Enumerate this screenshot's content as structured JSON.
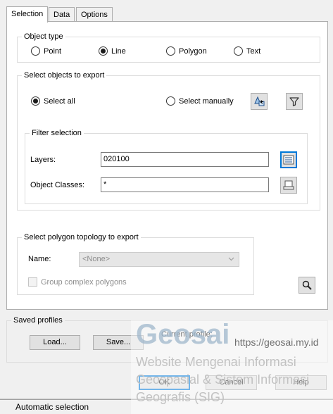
{
  "tabs": [
    {
      "label": "Selection",
      "active": true
    },
    {
      "label": "Data",
      "active": false
    },
    {
      "label": "Options",
      "active": false
    }
  ],
  "object_type": {
    "title": "Object type",
    "options": [
      {
        "label": "Point",
        "checked": false
      },
      {
        "label": "Line",
        "checked": true
      },
      {
        "label": "Polygon",
        "checked": false
      },
      {
        "label": "Text",
        "checked": false
      }
    ]
  },
  "select_objects": {
    "title": "Select objects to export",
    "select_all_label": "Select all",
    "select_all_checked": true,
    "select_manually_label": "Select manually",
    "select_manually_checked": false,
    "filter": {
      "title": "Filter selection",
      "layers_label": "Layers:",
      "layers_value": "020100",
      "classes_label": "Object Classes:",
      "classes_value": "*"
    }
  },
  "topology": {
    "title": "Select polygon topology to export",
    "name_label": "Name:",
    "name_value": "<None>",
    "group_label": "Group complex polygons",
    "group_checked": false
  },
  "saved_profiles": {
    "title": "Saved profiles",
    "load_label": "Load...",
    "save_label": "Save...",
    "current_label": "Current profile:"
  },
  "dialog_buttons": {
    "ok": "OK",
    "cancel": "Cancel",
    "help": "Help"
  },
  "status_text": "Automatic selection",
  "watermark": {
    "brand": "Geosai",
    "url": "https://geosai.my.id",
    "line1": "Website Mengenai Informasi",
    "line2": "Geospasial & Sistem Informasi",
    "line3": "Geografis (SIG)"
  },
  "colors": {
    "focus": "#0078d7",
    "panel_bg": "#ffffff",
    "dialog_bg": "#f0f0f0"
  }
}
